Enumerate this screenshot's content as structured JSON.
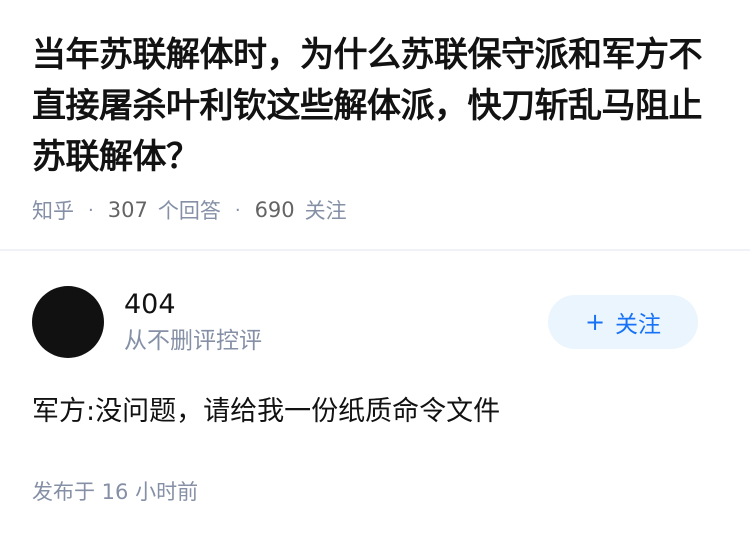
{
  "question": {
    "title": "当年苏联解体时，为什么苏联保守派和军方不直接屠杀叶利钦这些解体派，快刀斩乱马阻止苏联解体？",
    "source": "知乎",
    "separator": "·",
    "answer_count": "307",
    "answer_label": "个回答",
    "follower_count": "690",
    "follower_label": "关注"
  },
  "answer": {
    "author": {
      "name": "404",
      "bio": "从不删评控评",
      "avatar_icon": "avatar-dark-circle"
    },
    "follow_button": {
      "icon": "+",
      "label": "关注"
    },
    "content": "军方:没问题，请给我一份纸质命令文件",
    "publish_time": "发布于  16 小时前"
  },
  "colors": {
    "title": "#121212",
    "meta": "#8590a6",
    "accent": "#1772f6",
    "follow_bg": "#ebf5fd",
    "divider": "#f0f2f7"
  }
}
